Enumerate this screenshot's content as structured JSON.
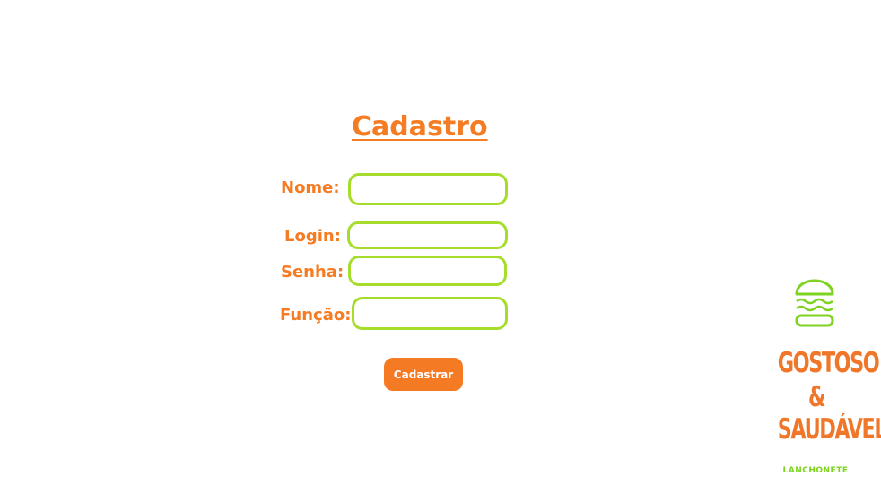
{
  "form": {
    "title": "Cadastro",
    "fields": [
      {
        "label": "Nome:",
        "value": "",
        "placeholder": ""
      },
      {
        "label": "Login:",
        "value": "",
        "placeholder": ""
      },
      {
        "label": "Senha:",
        "value": "",
        "placeholder": ""
      },
      {
        "label": "Função:",
        "value": "",
        "placeholder": ""
      }
    ],
    "submit_label": "Cadastrar"
  },
  "brand": {
    "line1": "GOSTOSO",
    "line2": "&",
    "line3": "SAUDÁVEL",
    "subtitle": "LANCHONETE",
    "icon": "burger-icon"
  },
  "colors": {
    "accent_orange": "#f57c22",
    "accent_green": "#a6dd2c",
    "background": "#ffffff"
  }
}
